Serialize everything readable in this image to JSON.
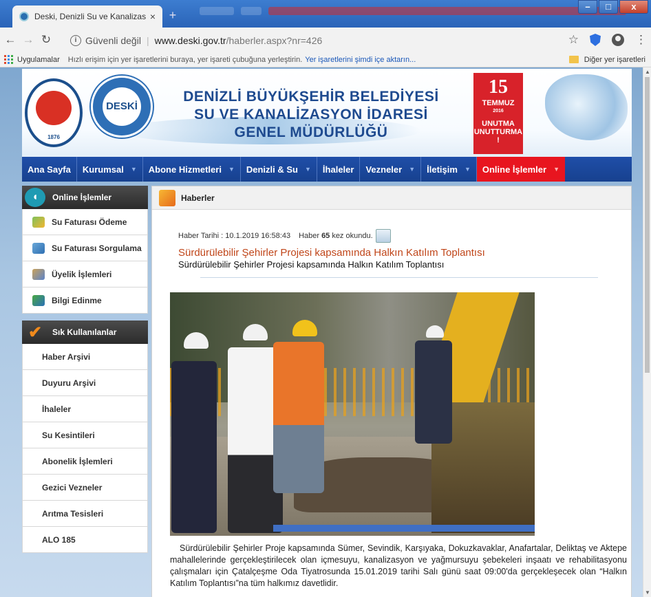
{
  "browser": {
    "tab_title": "Deski, Denizli Su ve Kanalizasyon",
    "close_glyph": "×",
    "new_tab_glyph": "+",
    "security_label": "Güvenli değil",
    "url_host": "www.deski.gov.tr",
    "url_path": "/haberler.aspx?nr=426",
    "star_glyph": "☆",
    "menu_glyph": "⋮",
    "window_minimize": "–",
    "window_maximize": "□",
    "window_close": "x"
  },
  "bookmarks": {
    "apps_label": "Uygulamalar",
    "hint_text": "Hızlı erişim için yer işaretlerini buraya, yer işareti çubuğuna yerleştirin.",
    "import_link": "Yer işaretlerini şimdi içe aktarın...",
    "other_bookmarks": "Diğer yer işaretleri"
  },
  "banner": {
    "title_line1": "DENİZLİ BÜYÜKŞEHİR BELEDİYESİ",
    "title_line2": "SU VE KANALİZASYON İDARESİ",
    "title_line3": "GENEL MÜDÜRLÜĞÜ",
    "logo1_year": "1876",
    "logo2_text": "DESKİ",
    "july_badge": {
      "number": "15",
      "month": "TEMMUZ",
      "year": "2016",
      "line1": "UNUTMA",
      "line2": "UNUTTURMA !"
    }
  },
  "nav": {
    "items": [
      {
        "label": "Ana Sayfa",
        "dropdown": false
      },
      {
        "label": "Kurumsal",
        "dropdown": true
      },
      {
        "label": "Abone Hizmetleri",
        "dropdown": true
      },
      {
        "label": "Denizli & Su",
        "dropdown": true
      },
      {
        "label": "İhaleler",
        "dropdown": false
      },
      {
        "label": "Vezneler",
        "dropdown": true
      },
      {
        "label": "İletişim",
        "dropdown": true
      },
      {
        "label": "Online İşlemler",
        "dropdown": true,
        "active": true
      }
    ],
    "caret_glyph": "▼"
  },
  "sidebar": {
    "online_title": "Online İşlemler",
    "online_items": [
      "Su Faturası Ödeme",
      "Su Faturası Sorgulama",
      "Üyelik İşlemleri",
      "Bilgi Edinme"
    ],
    "frequent_title": "Sık Kullanılanlar",
    "frequent_items": [
      "Haber Arşivi",
      "Duyuru Arşivi",
      "İhaleler",
      "Su Kesintileri",
      "Abonelik İşlemleri",
      "Gezici Vezneler",
      "Arıtma Tesisleri",
      "ALO 185"
    ]
  },
  "content": {
    "section_title": "Haberler",
    "date_label": "Haber Tarihi : 10.1.2019 16:58:43",
    "read_prefix": "Haber",
    "read_count": "65",
    "read_suffix": "kez okundu.",
    "news_title": "Sürdürülebilir Şehirler Projesi kapsamında Halkın Katılım Toplantısı",
    "news_subtitle": "Sürdürülebilir Şehirler Projesi kapsamında Halkın Katılım Toplantısı",
    "body": "Sürdürülebilir Şehirler Proje kapsamında Sümer, Sevindik, Karşıyaka, Dokuzkavaklar, Anafartalar, Deliktaş ve Aktepe mahallelerinde gerçekleştirilecek olan içmesuyu, kanalizasyon ve yağmursuyu şebekeleri inşaatı ve rehabilitasyonu çalışmaları için Çatalçeşme Oda Tiyatrosunda 15.01.2019 tarihi Salı günü saat 09:00'da gerçekleşecek olan “Halkın Katılım Toplantısı”na tüm halkımız davetlidir."
  },
  "colors": {
    "nav_bg": "#1f4ea8",
    "nav_active": "#e8151f",
    "title_blue": "#1e4a8f",
    "news_title": "#c0461a"
  }
}
